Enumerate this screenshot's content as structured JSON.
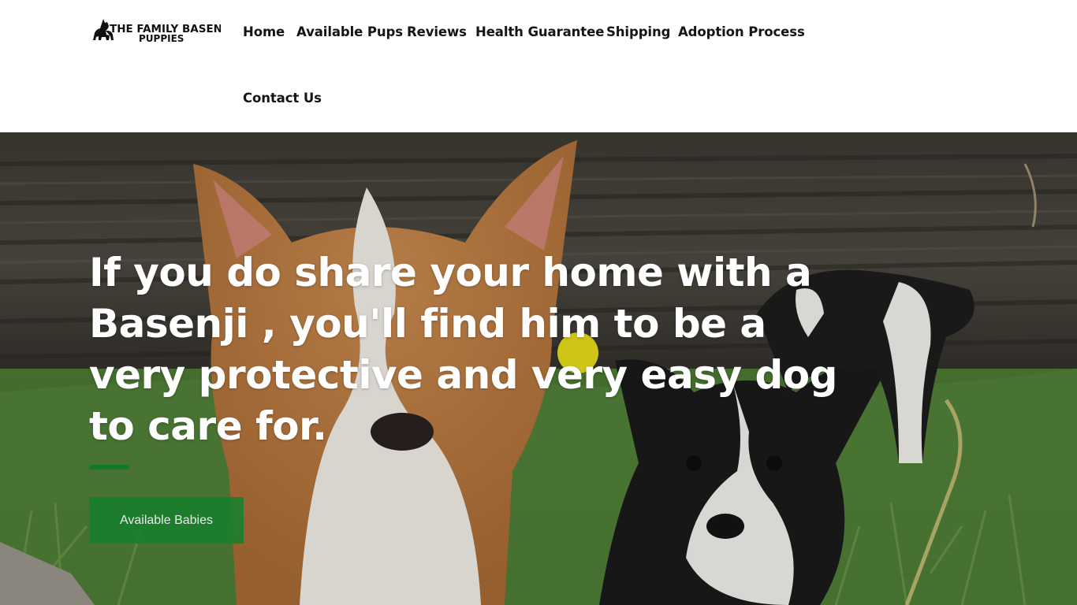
{
  "site": {
    "logo_text_line1": "THE FAMILY BASENJI",
    "logo_text_line2": "PUPPIES"
  },
  "nav": {
    "items": [
      {
        "label": "Home"
      },
      {
        "label": "Available Pups"
      },
      {
        "label": "Reviews"
      },
      {
        "label": "Health Guarantee"
      },
      {
        "label": "Shipping"
      },
      {
        "label": "Adoption Process"
      },
      {
        "label": "Contact Us"
      }
    ]
  },
  "hero": {
    "headline": "If you do share your home with a Basenji , you'll find him to be a very protective and very easy dog to care for.",
    "cta_label": "Available Babies"
  },
  "colors": {
    "accent": "#117a2a",
    "button": "#17802c",
    "nav_text": "#151515"
  }
}
